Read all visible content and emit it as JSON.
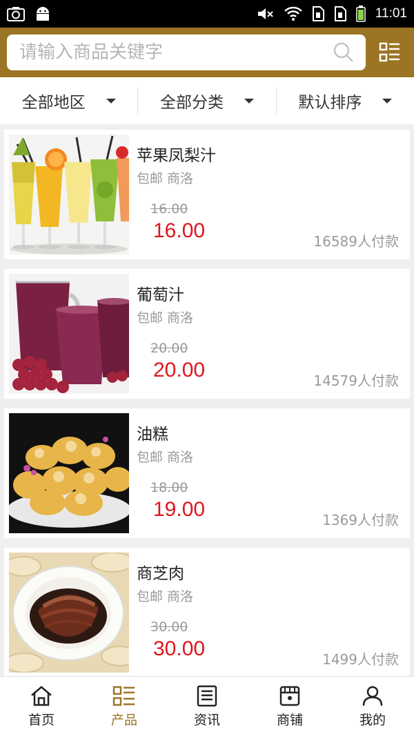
{
  "status_bar": {
    "time": "11:01"
  },
  "search": {
    "placeholder": "请输入商品关键字"
  },
  "filters": [
    {
      "label": "全部地区"
    },
    {
      "label": "全部分类"
    },
    {
      "label": "默认排序"
    }
  ],
  "products": [
    {
      "title": "苹果凤梨汁",
      "tags": "包邮 商洛",
      "original_price": "16.00",
      "price": "16.00",
      "sold": "16589人付款",
      "image": "pineapple-juice-glasses"
    },
    {
      "title": "葡萄汁",
      "tags": "包邮 商洛",
      "original_price": "20.00",
      "price": "20.00",
      "sold": "14579人付款",
      "image": "grape-juice-pitcher"
    },
    {
      "title": "油糕",
      "tags": "包邮 商洛",
      "original_price": "18.00",
      "price": "19.00",
      "sold": "1369人付款",
      "image": "fried-cakes-plate"
    },
    {
      "title": "商芝肉",
      "tags": "包邮 商洛",
      "original_price": "30.00",
      "price": "30.00",
      "sold": "1499人付款",
      "image": "braised-pork-plate"
    }
  ],
  "bottom_nav": [
    {
      "label": "首页",
      "icon": "home-icon"
    },
    {
      "label": "产品",
      "icon": "product-grid-icon"
    },
    {
      "label": "资讯",
      "icon": "news-icon"
    },
    {
      "label": "商铺",
      "icon": "shop-icon"
    },
    {
      "label": "我的",
      "icon": "user-icon"
    }
  ],
  "colors": {
    "brand": "#9b7424",
    "price": "#e0151c",
    "background": "#efefef"
  }
}
